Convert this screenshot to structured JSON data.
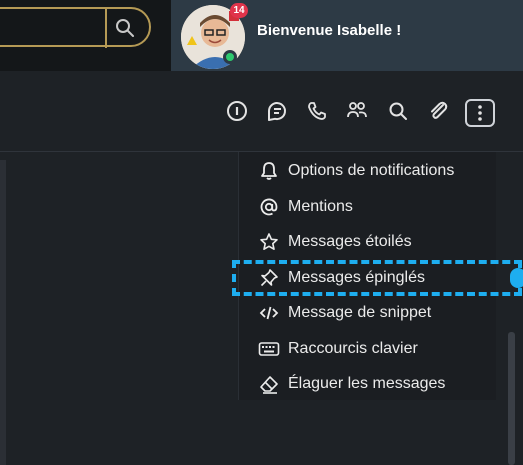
{
  "header": {
    "welcome_text": "Bienvenue Isabelle !",
    "notification_count": "14",
    "search_icon": "search-icon",
    "avatar_icon": "avatar"
  },
  "toolbar": {
    "icons": [
      "info-icon",
      "threads-icon",
      "phone-icon",
      "members-icon",
      "search-icon",
      "attachment-icon",
      "kebab-menu-icon"
    ]
  },
  "menu": {
    "items": [
      {
        "label": "Options de notifications",
        "icon": "bell-icon"
      },
      {
        "label": "Mentions",
        "icon": "at-sign-icon"
      },
      {
        "label": "Messages étoilés",
        "icon": "star-icon"
      },
      {
        "label": "Messages épinglés",
        "icon": "pin-icon"
      },
      {
        "label": "Message de snippet",
        "icon": "code-icon"
      },
      {
        "label": "Raccourcis clavier",
        "icon": "keyboard-icon"
      },
      {
        "label": "Élaguer les messages",
        "icon": "eraser-icon"
      }
    ]
  },
  "colors": {
    "accent": "#1eaef0",
    "search_border": "#b59a55",
    "status_online": "#2ec96f",
    "badge": "#e0344b"
  }
}
